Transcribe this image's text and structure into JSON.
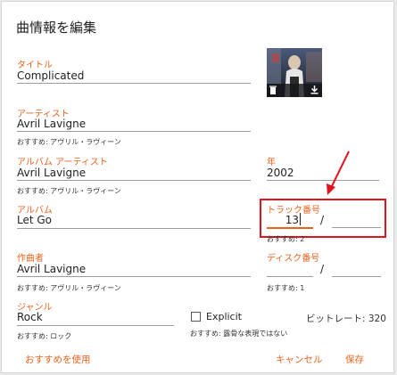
{
  "dialog": {
    "title": "曲情報を編集"
  },
  "fields": {
    "title": {
      "label": "タイトル",
      "value": "Complicated"
    },
    "artist": {
      "label": "アーティスト",
      "value": "Avril Lavigne",
      "suggestion": "おすすめ: アヴリル・ラヴィーン"
    },
    "album_artist": {
      "label": "アルバム アーティスト",
      "value": "Avril Lavigne",
      "suggestion": "おすすめ: アヴリル・ラヴィーン"
    },
    "year": {
      "label": "年",
      "value": "2002"
    },
    "album": {
      "label": "アルバム",
      "value": "Let Go"
    },
    "track": {
      "label": "トラック番号",
      "value": "13",
      "total": "",
      "separator": "/",
      "suggestion": "おすすめ: 2"
    },
    "composer": {
      "label": "作曲者",
      "value": "Avril Lavigne",
      "suggestion": "おすすめ: アヴリル・ラヴィーン"
    },
    "disc": {
      "label": "ディスク番号",
      "value": "",
      "total": "",
      "separator": "/",
      "suggestion": "おすすめ: 1"
    },
    "genre": {
      "label": "ジャンル",
      "value": "Rock",
      "suggestion": "おすすめ: ロック"
    },
    "explicit": {
      "label": "Explicit",
      "checked": false,
      "suggestion": "おすすめ: 露骨な表現ではない"
    },
    "bitrate": "ビットレート: 320"
  },
  "buttons": {
    "use_suggestions": "おすすめを使用",
    "cancel": "キャンセル",
    "save": "保存"
  },
  "colors": {
    "accent": "#e8641e",
    "highlight": "#e0141e",
    "arrow": "#e0141e"
  },
  "icons": {
    "art_delete": "trash-icon",
    "art_download": "download-icon"
  }
}
